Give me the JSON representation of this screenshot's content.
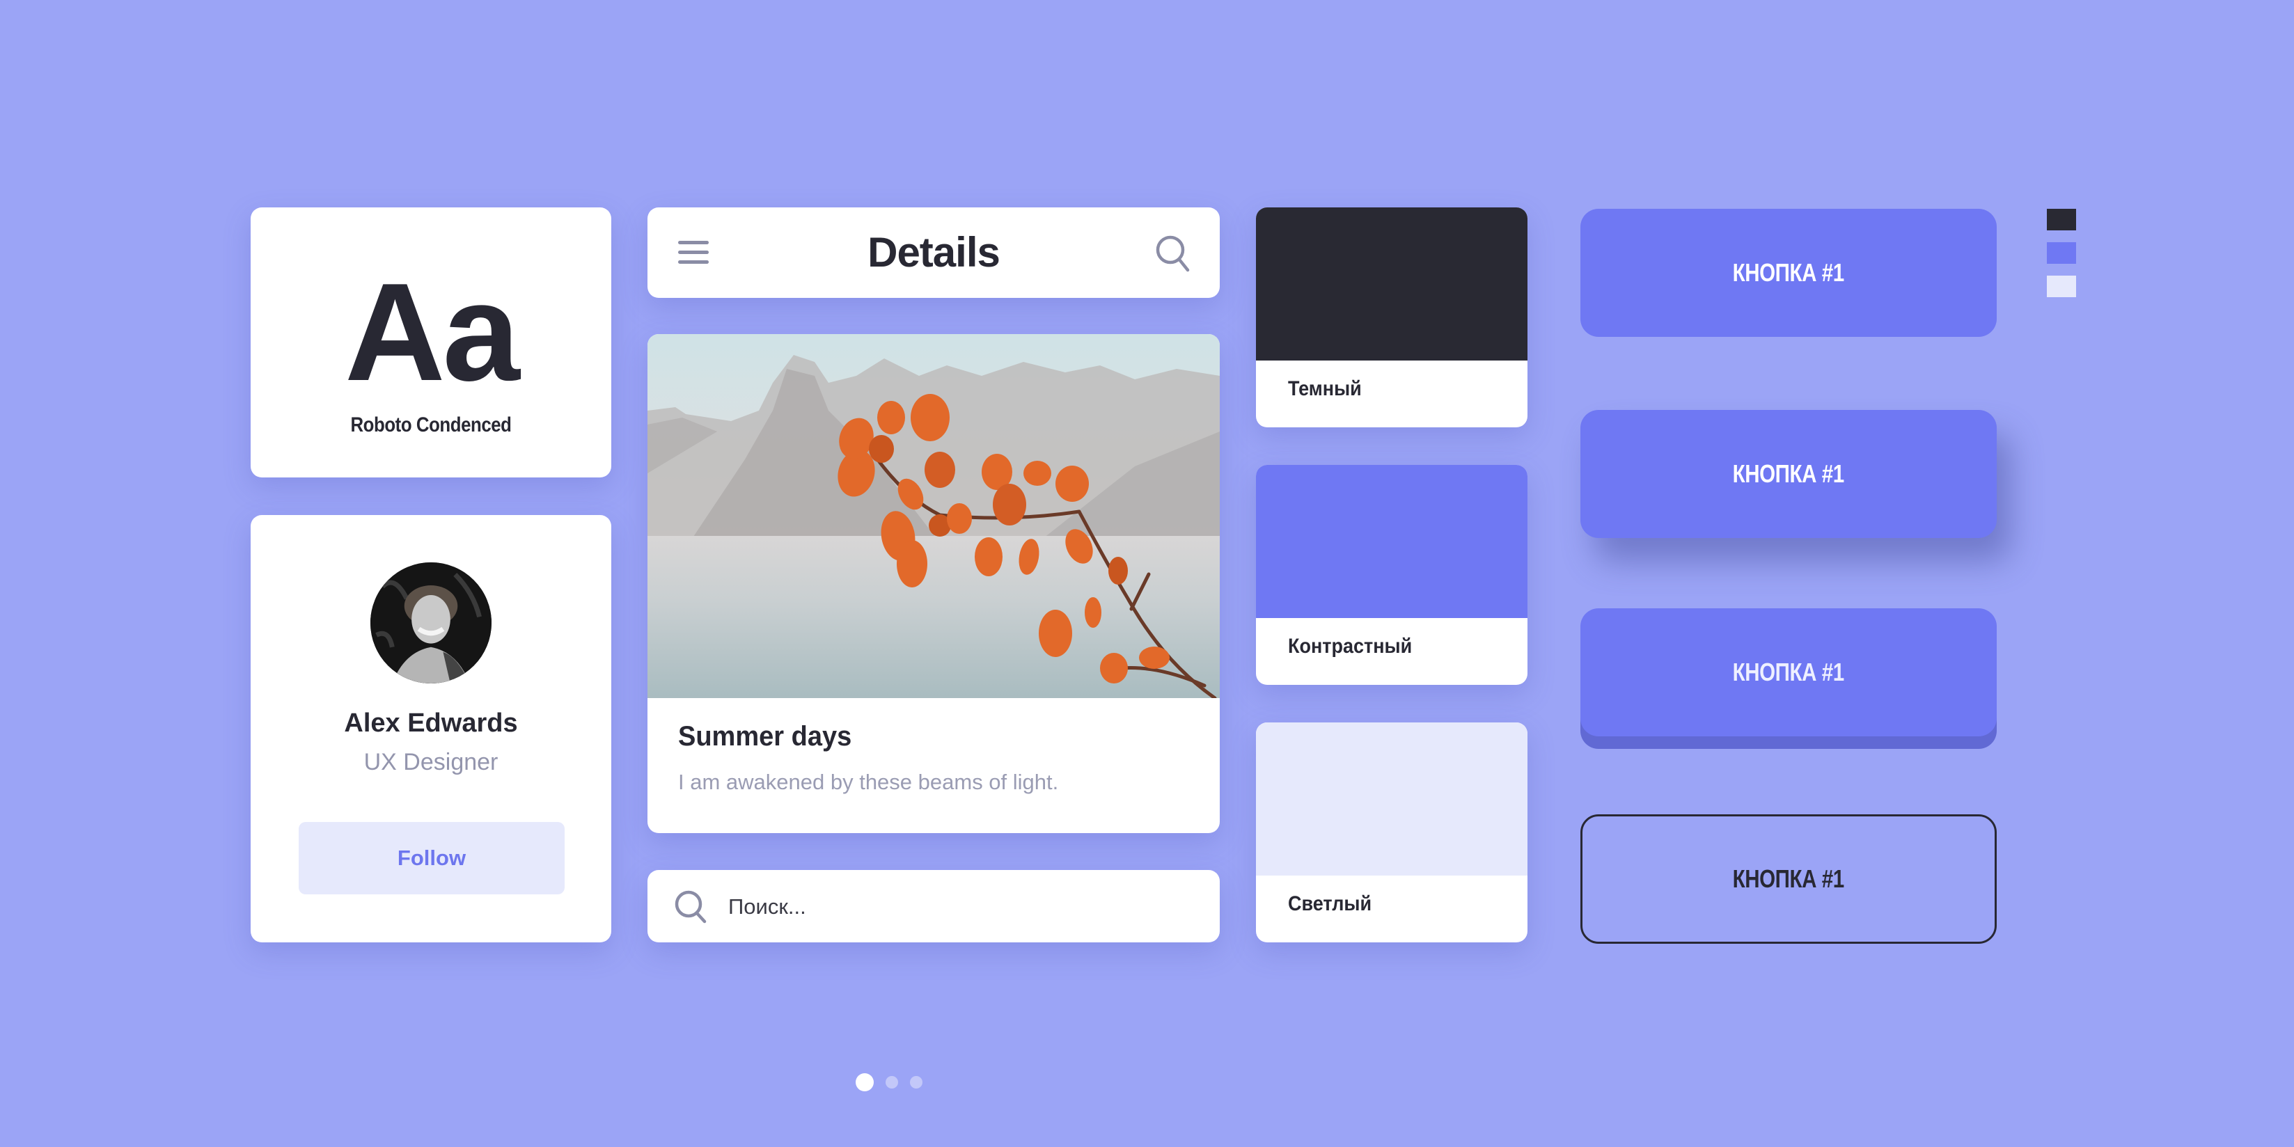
{
  "typography": {
    "sample": "Aa",
    "font_name": "Roboto Condenced"
  },
  "profile": {
    "avatar_icon": "person-photo",
    "name": "Alex Edwards",
    "role": "UX Designer",
    "follow_label": "Follow"
  },
  "details_header": {
    "menu_icon": "hamburger-menu-icon",
    "title": "Details",
    "search_icon": "search-icon"
  },
  "post": {
    "image_alt": "Autumn branch with orange leaves over a misty mountain lake",
    "title": "Summer days",
    "text": "I am awakened by these beams of light."
  },
  "search": {
    "icon": "search-icon",
    "placeholder": "Поиск...",
    "value": ""
  },
  "swatches": [
    {
      "label": "Темный",
      "color": "#292933"
    },
    {
      "label": "Контрастный",
      "color": "#6f78f3"
    },
    {
      "label": "Светлый",
      "color": "#e6e9fc"
    }
  ],
  "buttons": [
    {
      "label": "КНОПКА #1",
      "style": "flat"
    },
    {
      "label": "КНОПКА #1",
      "style": "shadow"
    },
    {
      "label": "КНОПКА #1",
      "style": "3d"
    },
    {
      "label": "КНОПКА #1",
      "style": "outline"
    }
  ],
  "palette": [
    "#292933",
    "#6f78f3",
    "#e6e9fc"
  ],
  "colors": {
    "background": "#9ba4f6",
    "accent": "#6f78f3",
    "dark": "#282833",
    "muted_text": "#9395ad"
  },
  "pager": {
    "count": 3,
    "active_index": 0
  }
}
